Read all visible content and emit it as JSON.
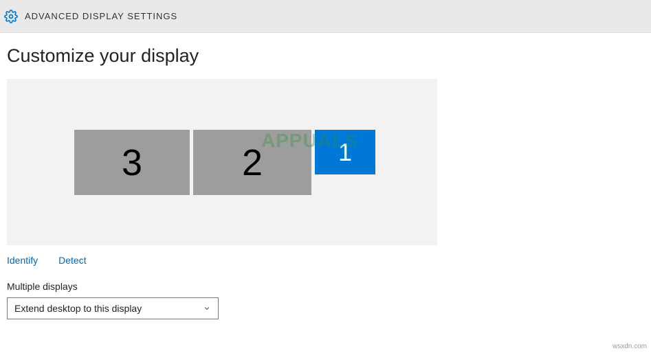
{
  "header": {
    "title": "ADVANCED DISPLAY SETTINGS"
  },
  "page": {
    "title": "Customize your display"
  },
  "displays": {
    "monitor3": "3",
    "monitor2": "2",
    "monitor1": "1",
    "watermark": "APPUALS"
  },
  "links": {
    "identify": "Identify",
    "detect": "Detect"
  },
  "multiple_displays": {
    "label": "Multiple displays",
    "selected": "Extend desktop to this display"
  },
  "attribution": "wsxdn.com"
}
